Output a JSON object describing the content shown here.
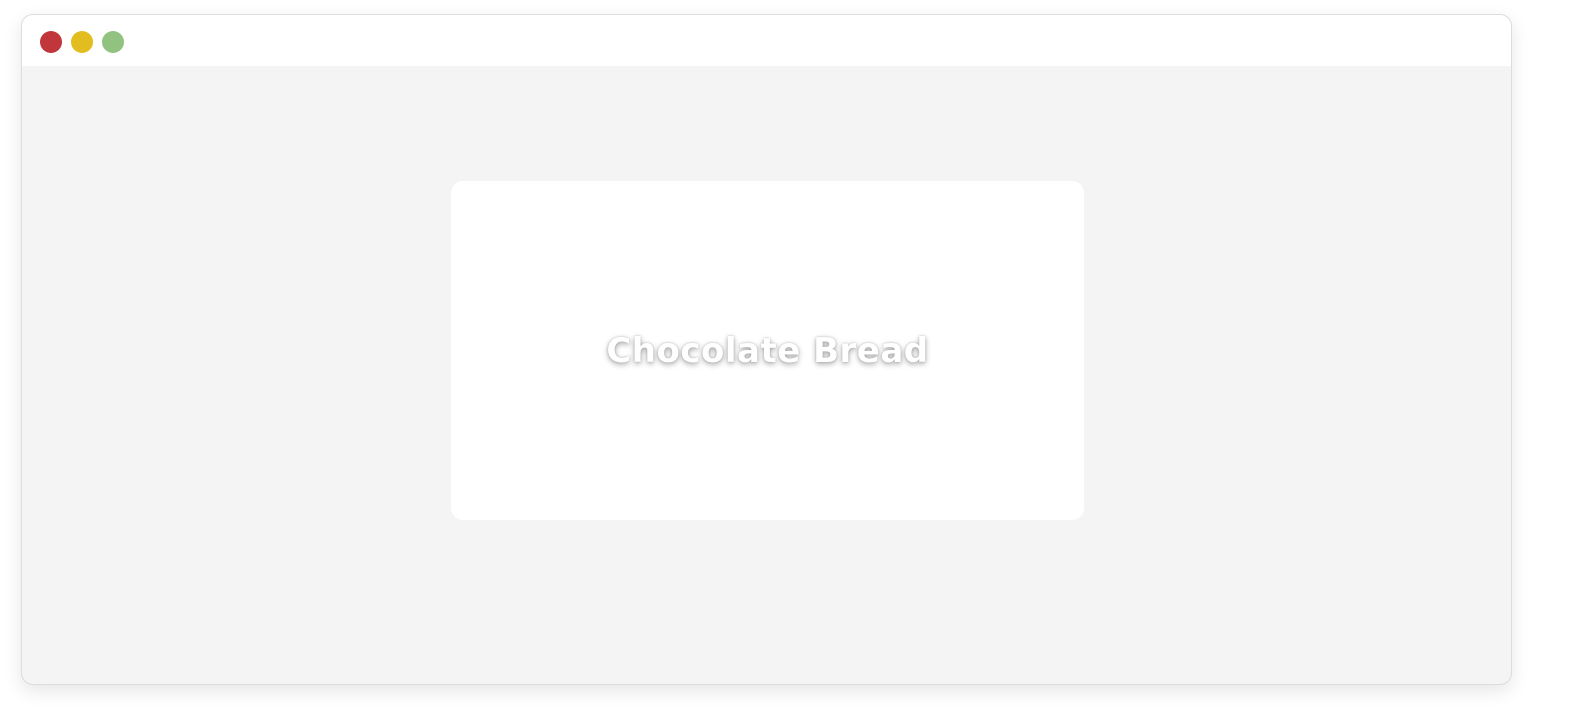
{
  "window": {
    "controls": [
      {
        "name": "close",
        "color": "#c0363a"
      },
      {
        "name": "minimize",
        "color": "#e2bd1f"
      },
      {
        "name": "maximize",
        "color": "#92c27f"
      }
    ]
  },
  "card": {
    "title": "Chocolate Bread"
  }
}
